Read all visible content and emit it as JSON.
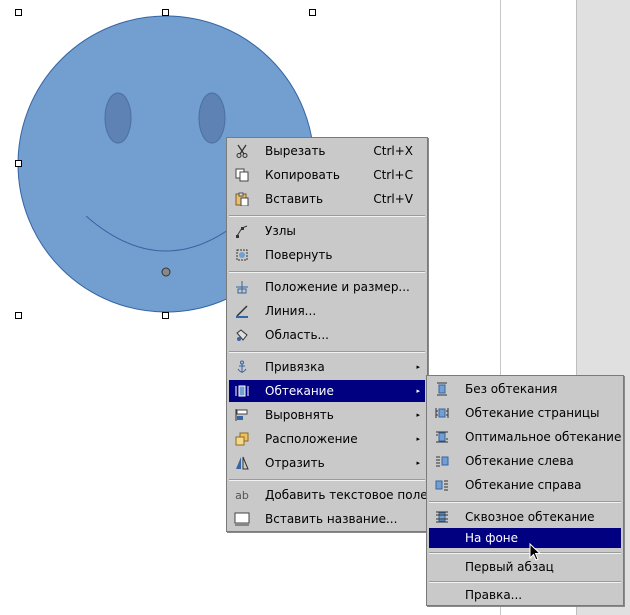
{
  "colors": {
    "shape_fill": "#729fcf",
    "shape_stroke": "#3465a4",
    "eye_fill": "#5d82b3",
    "menu_bg": "#c9c9c9",
    "highlight": "#000080"
  },
  "context_menu": {
    "cut": {
      "label": "Вырезать",
      "shortcut": "Ctrl+X",
      "icon": "scissors-icon"
    },
    "copy": {
      "label": "Копировать",
      "shortcut": "Ctrl+C",
      "icon": "copy-icon"
    },
    "paste": {
      "label": "Вставить",
      "shortcut": "Ctrl+V",
      "icon": "paste-icon"
    },
    "points": {
      "label": "Узлы",
      "icon": "points-icon"
    },
    "rotate": {
      "label": "Повернуть",
      "icon": "rotate-icon"
    },
    "position_size": {
      "label": "Положение и размер...",
      "icon": "position-size-icon"
    },
    "line": {
      "label": "Линия...",
      "icon": "line-icon"
    },
    "area": {
      "label": "Область...",
      "icon": "area-icon"
    },
    "anchor": {
      "label": "Привязка",
      "icon": "anchor-icon"
    },
    "wrap": {
      "label": "Обтекание",
      "icon": "wrap-icon"
    },
    "align": {
      "label": "Выровнять",
      "icon": "align-icon"
    },
    "arrange": {
      "label": "Расположение",
      "icon": "arrange-icon"
    },
    "flip": {
      "label": "Отразить",
      "icon": "flip-icon"
    },
    "add_text_box": {
      "label": "Добавить текстовое поле",
      "icon": "text-box-icon"
    },
    "insert_caption": {
      "label": "Вставить название...",
      "icon": "caption-icon"
    }
  },
  "wrap_submenu": {
    "no_wrap": "Без обтекания",
    "page_wrap": "Обтекание страницы",
    "optimal_wrap": "Оптимальное обтекание",
    "wrap_left": "Обтекание слева",
    "wrap_right": "Обтекание справа",
    "wrap_through": "Сквозное обтекание",
    "in_background": "На фоне",
    "first_paragraph": "Первый абзац",
    "edit": "Правка..."
  }
}
